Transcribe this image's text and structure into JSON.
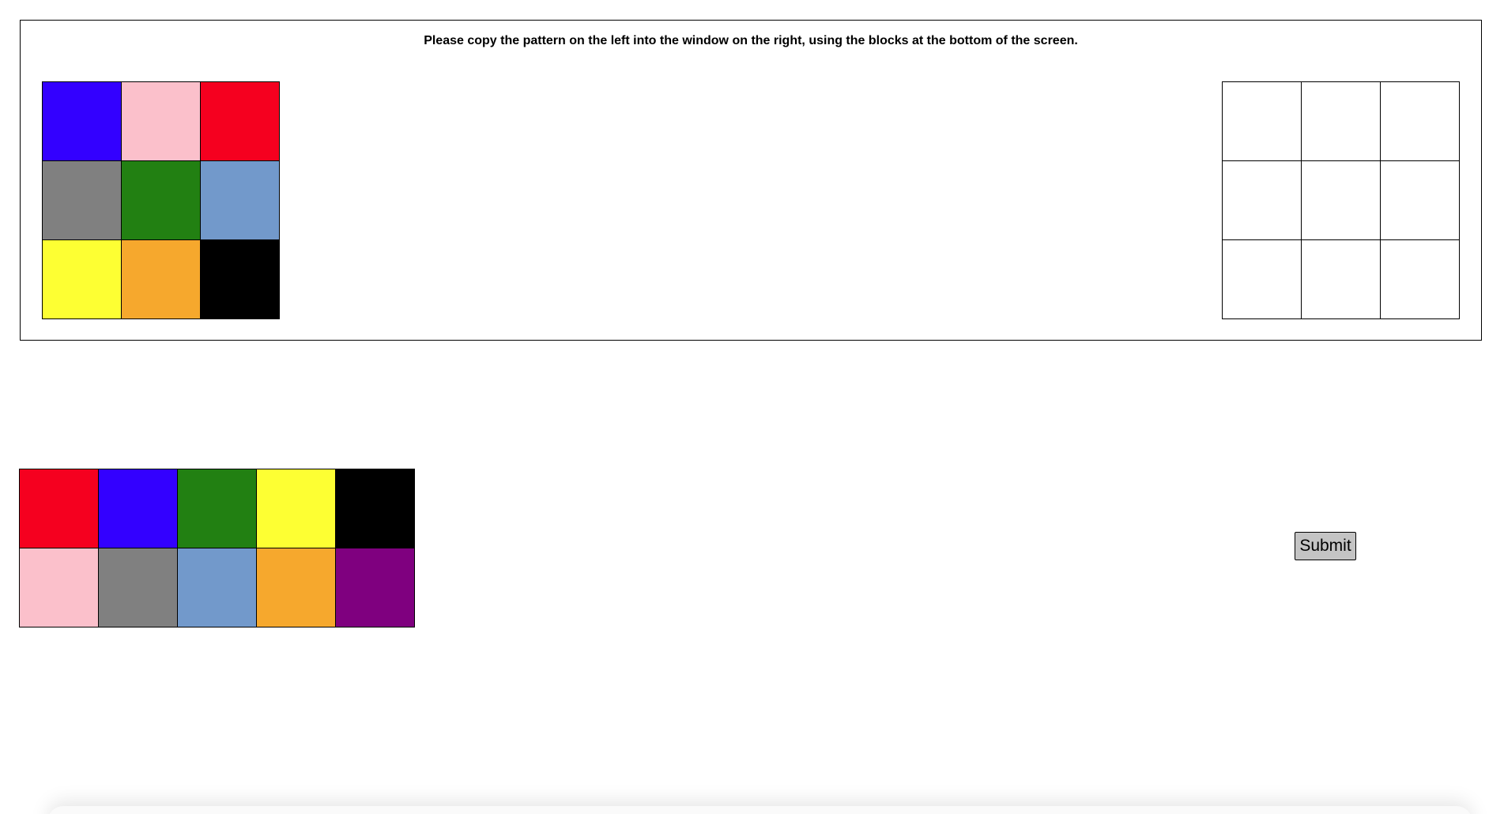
{
  "instructions": "Please copy the pattern on the left into the window on the right, using the blocks at the bottom of the screen.",
  "target_pattern": [
    {
      "name": "blue",
      "color": "#3300ff"
    },
    {
      "name": "pink",
      "color": "#fbc0cb"
    },
    {
      "name": "red",
      "color": "#f5001f"
    },
    {
      "name": "gray",
      "color": "#808080"
    },
    {
      "name": "green",
      "color": "#228012"
    },
    {
      "name": "light-blue",
      "color": "#7299cb"
    },
    {
      "name": "yellow",
      "color": "#fdff33"
    },
    {
      "name": "orange",
      "color": "#f6a82d"
    },
    {
      "name": "black",
      "color": "#000000"
    }
  ],
  "answer_cells": [
    null,
    null,
    null,
    null,
    null,
    null,
    null,
    null,
    null
  ],
  "palette_blocks": [
    {
      "name": "red",
      "color": "#f5001f"
    },
    {
      "name": "blue",
      "color": "#3300ff"
    },
    {
      "name": "green",
      "color": "#228012"
    },
    {
      "name": "yellow",
      "color": "#fdff33"
    },
    {
      "name": "black",
      "color": "#000000"
    },
    {
      "name": "pink",
      "color": "#fbc0cb"
    },
    {
      "name": "gray",
      "color": "#808080"
    },
    {
      "name": "light-blue",
      "color": "#7299cb"
    },
    {
      "name": "orange",
      "color": "#f6a82d"
    },
    {
      "name": "purple",
      "color": "#7f007f"
    }
  ],
  "submit_label": "Submit"
}
